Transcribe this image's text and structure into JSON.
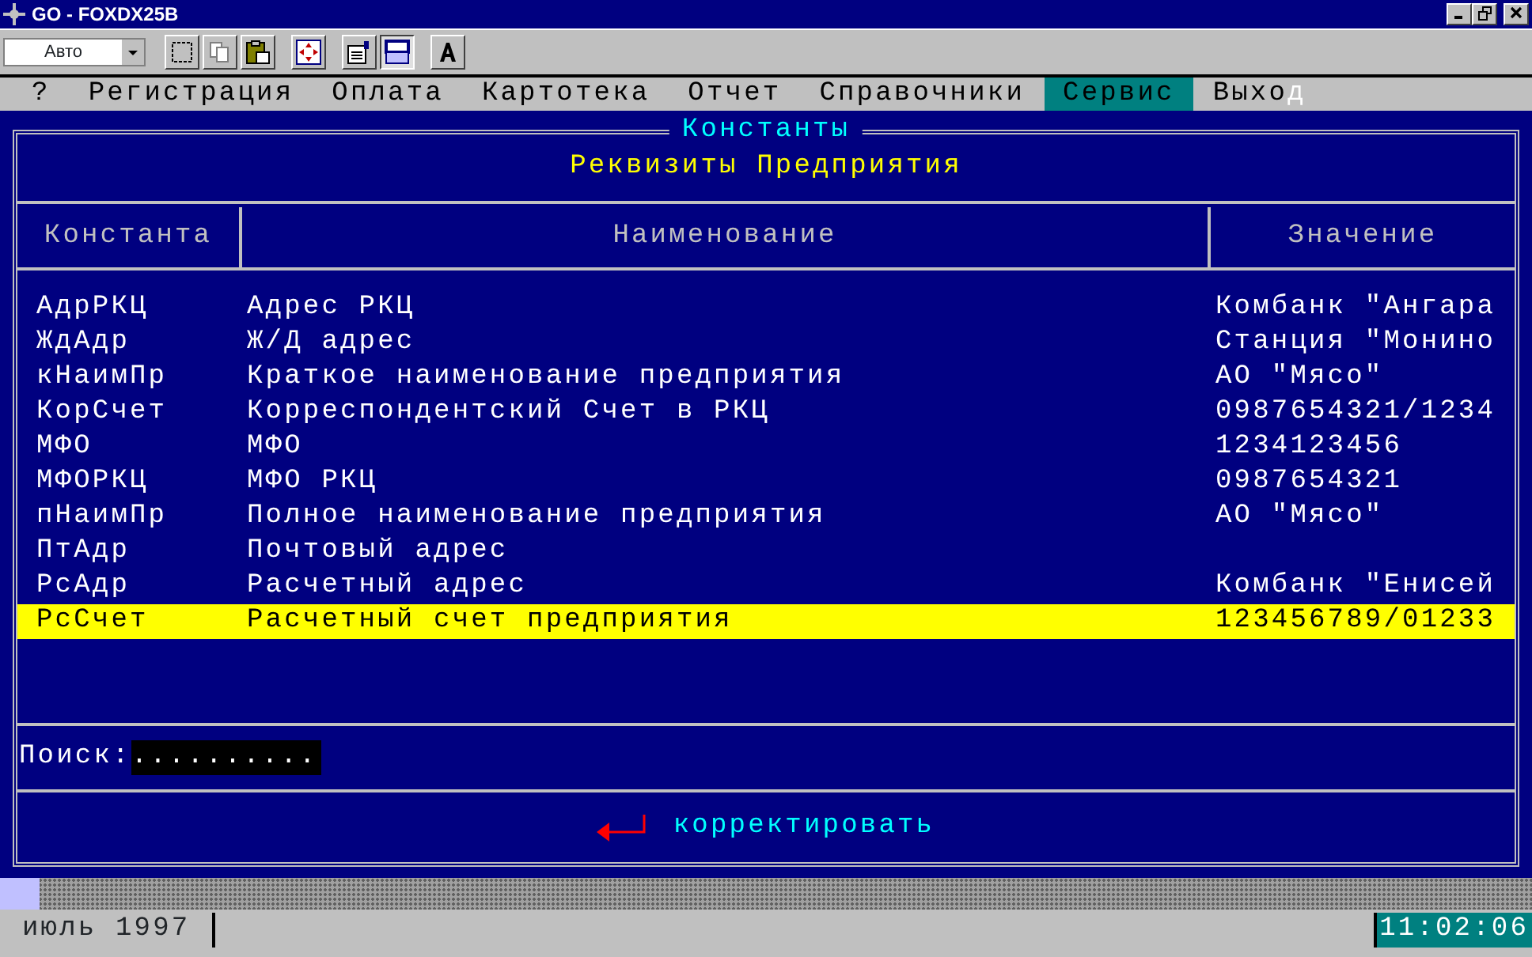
{
  "window": {
    "title": "GO - FOXDX25B"
  },
  "toolbar": {
    "combo_value": "Авто"
  },
  "menu": [
    {
      "label": "?",
      "selected": false
    },
    {
      "label": "Регистрация",
      "selected": false
    },
    {
      "label": "Оплата",
      "selected": false
    },
    {
      "label": "Картотека",
      "selected": false
    },
    {
      "label": "Отчет",
      "selected": false
    },
    {
      "label": "Справочники",
      "selected": false
    },
    {
      "label": "Сервис",
      "selected": true
    },
    {
      "label": "Выхо",
      "tail": "д",
      "selected": false
    }
  ],
  "dialog": {
    "title": "Константы",
    "subtitle": "Реквизиты Предприятия"
  },
  "table": {
    "columns": [
      "Константа",
      "Наименование",
      "Значение"
    ],
    "rows": [
      {
        "cells": [
          "АдрРКЦ",
          "Адрес РКЦ",
          "Комбанк \"Ангара"
        ],
        "selected": false
      },
      {
        "cells": [
          "ЖдАдр",
          "Ж/Д адрес",
          "Станция \"Монино"
        ],
        "selected": false
      },
      {
        "cells": [
          "кНаимПр",
          "Краткое наименование предприятия",
          "АО \"Мясо\""
        ],
        "selected": false
      },
      {
        "cells": [
          "КорСчет",
          "Корреспондентский Счет в РКЦ",
          "0987654321/1234"
        ],
        "selected": false
      },
      {
        "cells": [
          "МФО",
          "МФО",
          "1234123456"
        ],
        "selected": false
      },
      {
        "cells": [
          "МФОРКЦ",
          "МФО РКЦ",
          "0987654321"
        ],
        "selected": false
      },
      {
        "cells": [
          "пНаимПр",
          "Полное наименование предприятия",
          "АО \"Мясо\""
        ],
        "selected": false
      },
      {
        "cells": [
          "ПтАдр",
          "Почтовый адрес",
          ""
        ],
        "selected": false
      },
      {
        "cells": [
          "РсАдр",
          "Расчетный адрес",
          "Комбанк \"Енисей"
        ],
        "selected": false
      },
      {
        "cells": [
          "РсСчет",
          "Расчетный счет предприятия",
          "123456789/01233"
        ],
        "selected": true
      }
    ]
  },
  "search": {
    "label": "Поиск:",
    "value": ".........."
  },
  "action": {
    "label": "корректировать"
  },
  "status_bar": {
    "date": "июль 1997",
    "time": "11:02:06"
  }
}
